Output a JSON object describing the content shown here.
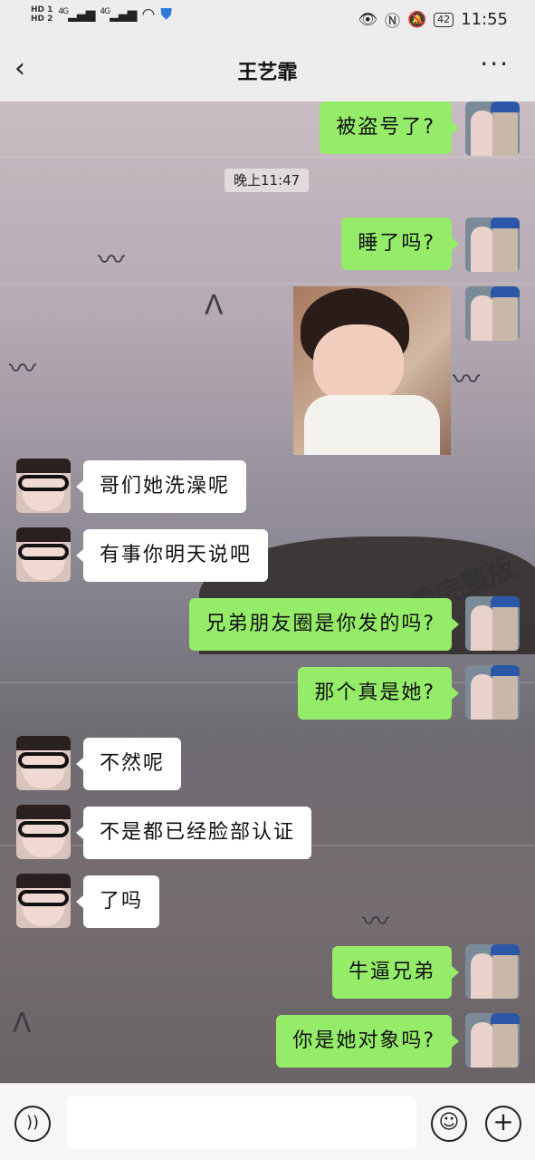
{
  "status_bar": {
    "left_indicators": [
      "HD 1",
      "HD 2"
    ],
    "signal_1": "4G",
    "signal_2": "4G",
    "battery": "42",
    "time": "11:55"
  },
  "header": {
    "back_label": "‹",
    "title": "王艺霏",
    "more_label": "···"
  },
  "chat": {
    "timestamp": "晚上11:47",
    "watermark": "155.hn看完整版",
    "messages": [
      {
        "side": "right",
        "text": "被盗号了?"
      },
      {
        "side": "right",
        "text": "睡了吗?"
      },
      {
        "side": "right",
        "type": "sticker",
        "text": ""
      },
      {
        "side": "left",
        "text": "哥们她洗澡呢"
      },
      {
        "side": "left",
        "text": "有事你明天说吧"
      },
      {
        "side": "right",
        "text": "兄弟朋友圈是你发的吗?"
      },
      {
        "side": "right",
        "text": "那个真是她?"
      },
      {
        "side": "left",
        "text": "不然呢"
      },
      {
        "side": "left",
        "text": "不是都已经脸部认证"
      },
      {
        "side": "left",
        "text": "了吗"
      },
      {
        "side": "right",
        "text": "牛逼兄弟"
      },
      {
        "side": "right",
        "text": "你是她对象吗?"
      }
    ]
  },
  "input_bar": {
    "voice_icon": "voice-icon",
    "emoji_icon": "emoji-icon",
    "plus_icon": "plus-icon",
    "placeholder": ""
  },
  "colors": {
    "outgoing_bubble": "#95ec69",
    "incoming_bubble": "#ffffff",
    "bar_background": "#ededed"
  }
}
